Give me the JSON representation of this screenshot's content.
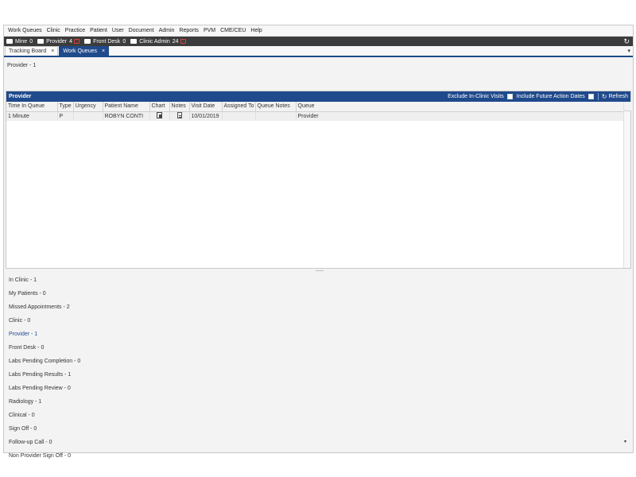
{
  "menu": [
    "Work Queues",
    "Clinic",
    "Practice",
    "Patient",
    "User",
    "Document",
    "Admin",
    "Reports",
    "PVM",
    "CME/CEU",
    "Help"
  ],
  "queues": [
    {
      "label": "Mine",
      "count": "0",
      "alert": ""
    },
    {
      "label": "Provider",
      "count": "4",
      "alert": "!"
    },
    {
      "label": "Front Desk",
      "count": "0",
      "alert": ""
    },
    {
      "label": "Clinic Admin",
      "count": "24",
      "alert": "!"
    }
  ],
  "refresh_icon": "↻",
  "tabs": [
    {
      "label": "Tracking Board",
      "close": "×",
      "active": false
    },
    {
      "label": "Work Queues",
      "close": "×",
      "active": true
    }
  ],
  "tab_dropdown": "▾",
  "section_title": "Provider - 1",
  "panel": {
    "title": "Provider",
    "exclude_label": "Exclude In-Clinic Visits",
    "include_label": "Include Future Action Dates",
    "refresh_label": "Refresh",
    "refresh_icon": "↻"
  },
  "columns": [
    "Time In Queue",
    "Type",
    "Urgency",
    "Patient Name",
    "Chart",
    "Notes",
    "Visit Date",
    "Assigned To",
    "Queue Notes",
    "Queue"
  ],
  "rows": [
    {
      "time": "1 Minute",
      "type": "P",
      "urgency": "",
      "patient": "ROBYN CONTI",
      "chart_icon": "chart-icon",
      "notes_icon": "notes-icon",
      "visit_date": "10/01/2019",
      "assigned": "",
      "queue_notes": "",
      "queue": "Provider"
    }
  ],
  "queue_list": [
    "In Clinic - 1",
    "My Patients - 0",
    "Missed Appointments - 2",
    "Clinic - 0",
    "Provider - 1",
    "Front Desk - 0",
    "Labs Pending Completion - 0",
    "Labs Pending Results - 1",
    "Labs Pending Review - 0",
    "Radiology - 1",
    "Clinical - 0",
    "Sign Off - 0",
    "Follow-up Call - 0",
    "Non Provider Sign Off - 0"
  ],
  "active_queue_index": 4,
  "corner_arrow": "▾",
  "colors": {
    "accent": "#1f4a8c",
    "toolbar": "#3c3c3c",
    "alert": "#d9443d"
  }
}
